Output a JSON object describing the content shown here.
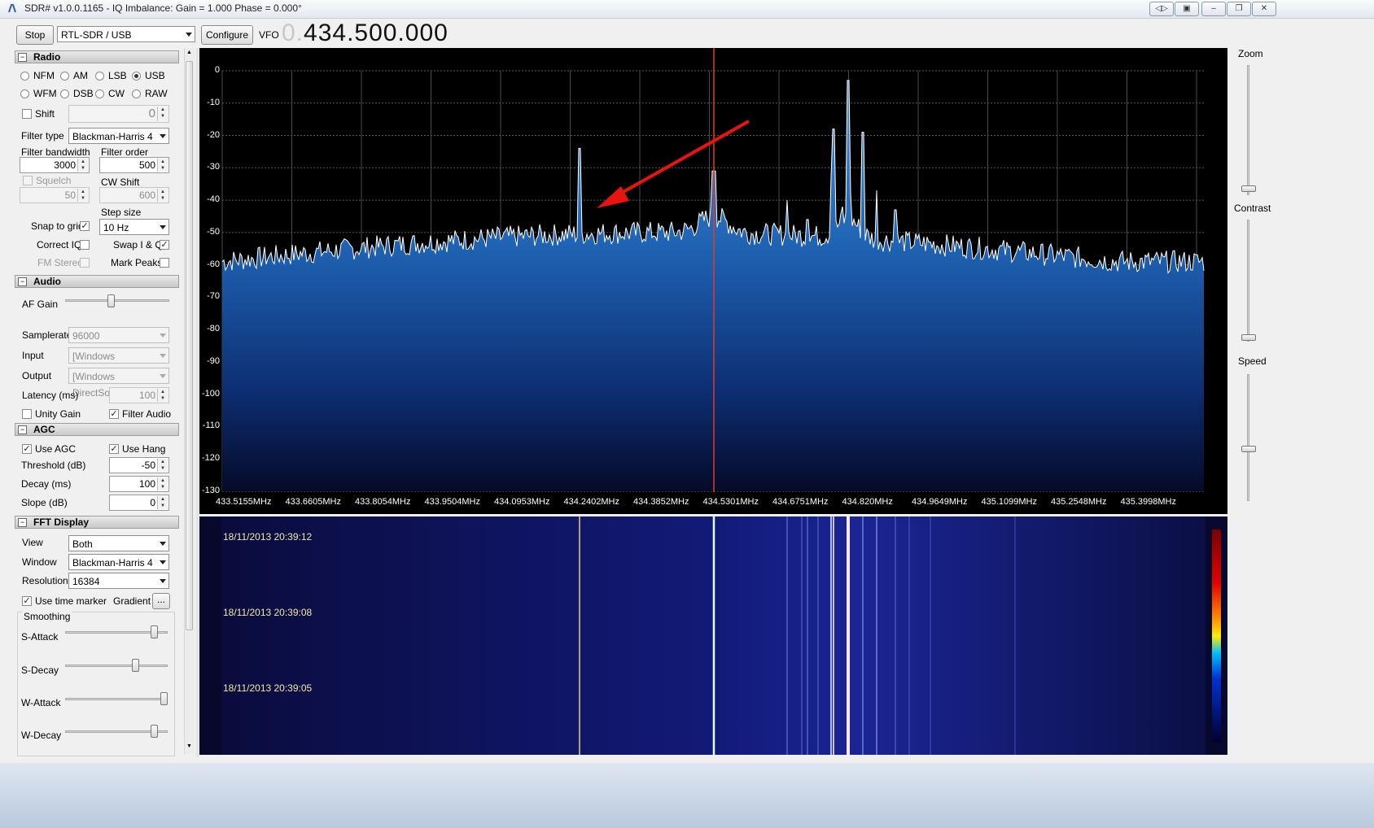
{
  "window": {
    "title": "SDR# v1.0.0.1165 - IQ Imbalance: Gain = 1.000 Phase = 0.000°",
    "buttons": [
      "restore-icon",
      "pin-icon",
      "minimize-icon",
      "maximize-icon",
      "close-icon"
    ]
  },
  "toolbar": {
    "stop_label": "Stop",
    "device": "RTL-SDR / USB",
    "configure_label": "Configure",
    "vfo_label": "VFO",
    "vfo_prefix": "0.",
    "vfo_value": "434.500.000"
  },
  "radio": {
    "header": "Radio",
    "modes": [
      "NFM",
      "AM",
      "LSB",
      "USB",
      "WFM",
      "DSB",
      "CW",
      "RAW"
    ],
    "selected_mode": "USB",
    "shift_label": "Shift",
    "shift_value": "0",
    "filter_type_label": "Filter type",
    "filter_type": "Blackman-Harris 4",
    "filter_bandwidth_label": "Filter bandwidth",
    "filter_bandwidth": "3000",
    "filter_order_label": "Filter order",
    "filter_order": "500",
    "squelch_label": "Squelch",
    "squelch_value": "50",
    "cw_shift_label": "CW Shift",
    "cw_shift_value": "600",
    "step_size_label": "Step size",
    "snap_label": "Snap to grid",
    "step_size": "10 Hz",
    "correct_iq_label": "Correct IQ",
    "swap_iq_label": "Swap I & Q",
    "fm_stereo_label": "FM Stereo",
    "mark_peaks_label": "Mark Peaks"
  },
  "audio": {
    "header": "Audio",
    "af_gain_label": "AF Gain",
    "samplerate_label": "Samplerate",
    "samplerate": "96000",
    "input_label": "Input",
    "input": "[Windows DirectSound]",
    "output_label": "Output",
    "output": "[Windows DirectSound]",
    "latency_label": "Latency (ms)",
    "latency": "100",
    "unity_gain_label": "Unity Gain",
    "filter_audio_label": "Filter Audio"
  },
  "agc": {
    "header": "AGC",
    "use_agc_label": "Use AGC",
    "use_hang_label": "Use Hang",
    "threshold_label": "Threshold (dB)",
    "threshold": "-50",
    "decay_label": "Decay (ms)",
    "decay": "100",
    "slope_label": "Slope (dB)",
    "slope": "0"
  },
  "fft": {
    "header": "FFT Display",
    "view_label": "View",
    "view": "Both",
    "window_label": "Window",
    "window": "Blackman-Harris 4",
    "resolution_label": "Resolution",
    "resolution": "16384",
    "time_marker_label": "Use time marker",
    "gradient_label": "Gradient",
    "gradient_btn": "...",
    "smoothing_label": "Smoothing",
    "s_attack_label": "S-Attack",
    "s_decay_label": "S-Decay",
    "w_attack_label": "W-Attack",
    "w_decay_label": "W-Decay"
  },
  "spectrum": {
    "y_ticks": [
      "0",
      "-10",
      "-20",
      "-30",
      "-40",
      "-50",
      "-60",
      "-70",
      "-80",
      "-90",
      "-100",
      "-110",
      "-120",
      "-130"
    ],
    "x_ticks": [
      "433.5155MHz",
      "433.6605MHz",
      "433.8054MHz",
      "433.9504MHz",
      "434.0953MHz",
      "434.2402MHz",
      "434.3852MHz",
      "434.5301MHz",
      "434.6751MHz",
      "434.820MHz",
      "434.9649MHz",
      "435.1099MHz",
      "435.2548MHz",
      "435.3998MHz"
    ],
    "fill_color": "#2d78c6",
    "trace_color": "#ffffff",
    "marker_color": "#e23a2a"
  },
  "waterfall": {
    "timestamps": [
      "18/11/2013 20:39:12",
      "18/11/2013 20:39:08",
      "18/11/2013 20:39:05"
    ]
  },
  "right_panel": {
    "zoom_label": "Zoom",
    "contrast_label": "Contrast",
    "speed_label": "Speed"
  }
}
